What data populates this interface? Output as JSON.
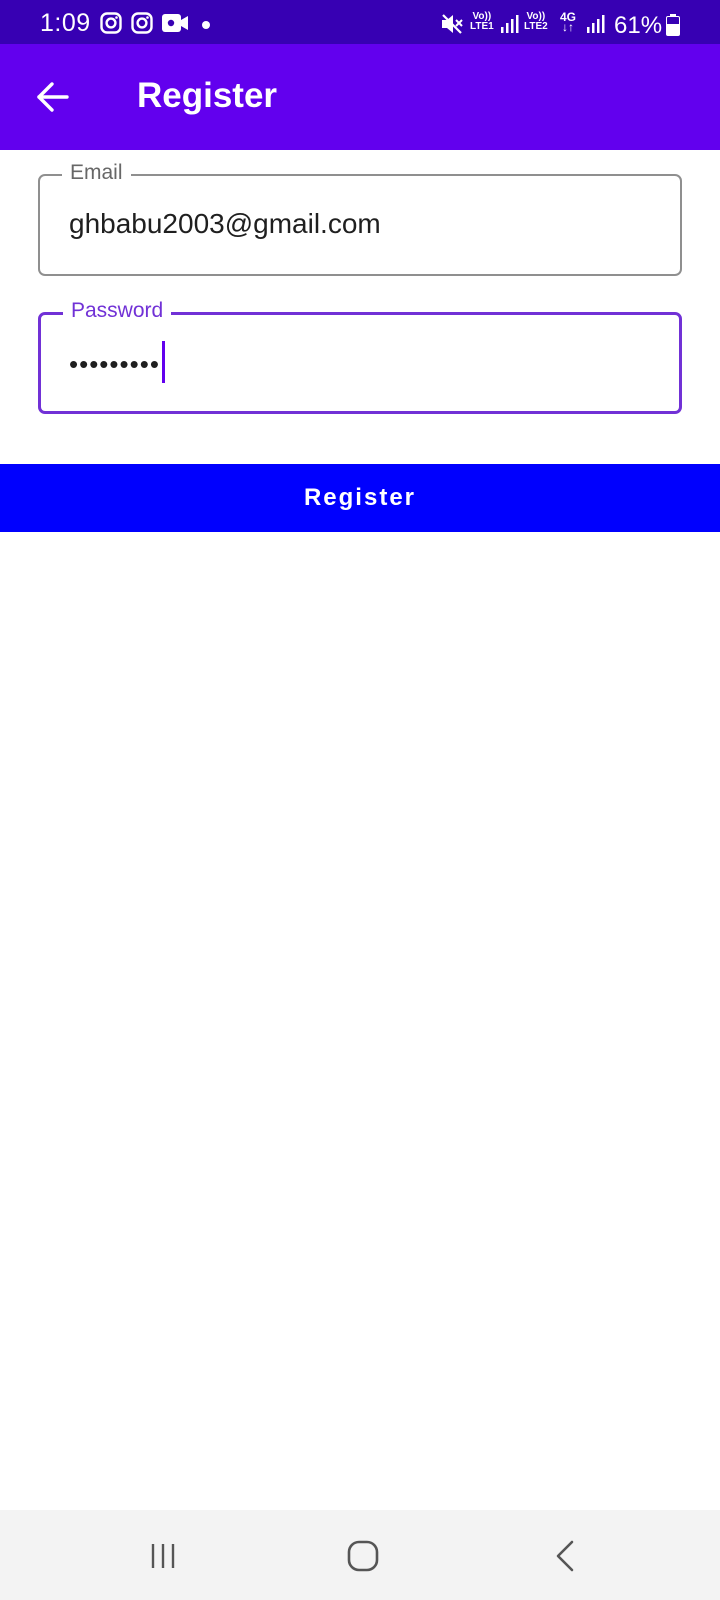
{
  "status_bar": {
    "time": "1:09",
    "sim1_label_top": "Vo))",
    "sim1_label_bottom": "LTE1",
    "sim2_label_top": "Vo))",
    "sim2_label_bottom": "LTE2",
    "network_type": "4G",
    "battery": "61%",
    "icons": [
      "instagram-icon",
      "instagram-icon",
      "video-camera-icon",
      "notification-dot",
      "mute-icon",
      "signal-icon",
      "signal-icon",
      "battery-icon"
    ]
  },
  "app_bar": {
    "title": "Register",
    "back_icon": "arrow-left-icon",
    "background": "#6200ee"
  },
  "form": {
    "email": {
      "label": "Email",
      "value": "ghbabu2003@gmail.com"
    },
    "password": {
      "label": "Password",
      "value": "•••••••••",
      "focused_color": "#7131d6"
    }
  },
  "register_button": {
    "label": "Register",
    "color": "#0000fe"
  },
  "nav_bar": {
    "buttons": [
      "recent-apps-icon",
      "home-icon",
      "back-icon"
    ]
  }
}
